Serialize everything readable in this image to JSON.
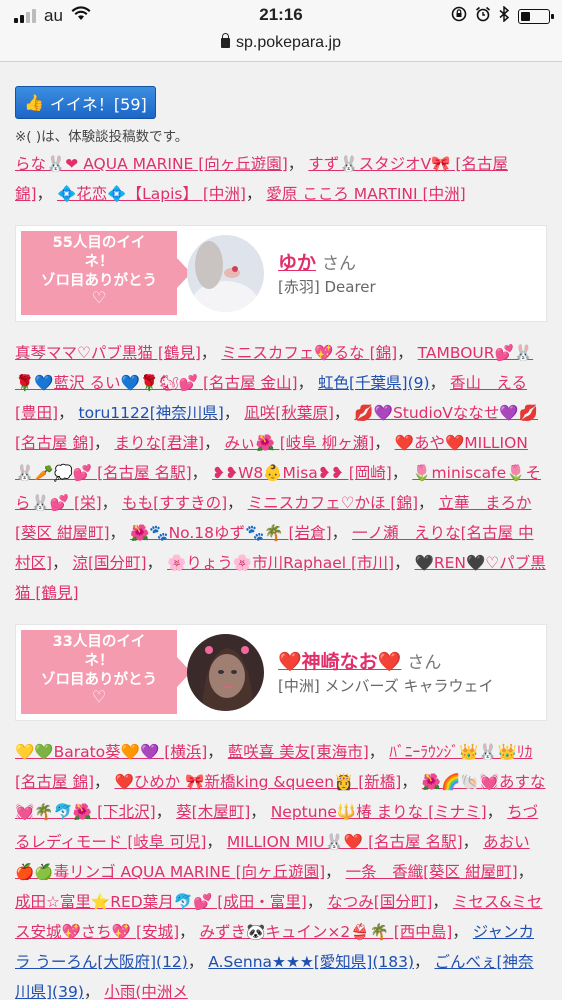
{
  "status_bar": {
    "carrier": "au",
    "time": "21:16",
    "battery_level": 0.35
  },
  "url_bar": {
    "domain": "sp.pokepara.jp"
  },
  "like_button": {
    "label": "イイネ！[59]"
  },
  "note": "※( )は、体験談投稿数です。",
  "cards": [
    {
      "banner_line1": "55人目のイイ",
      "banner_line2": "ネ！",
      "banner_line3": "ゾロ目ありがとう",
      "banner_heart": "♡",
      "name": "ゆか",
      "honorific": "さん",
      "shop": "[赤羽] Dearer"
    },
    {
      "banner_line1": "33人目のイイ",
      "banner_line2": "ネ！",
      "banner_line3": "ゾロ目ありがとう",
      "banner_heart": "♡",
      "name": "❤️神崎なお❤️",
      "honorific": "さん",
      "shop": "[中洲] メンバーズ キャラウェイ"
    }
  ],
  "likers_block_1": [
    {
      "text": "らな🐰❤ AQUA MARINE [向ヶ丘遊園]",
      "sep": "，"
    },
    {
      "text": "すず🐰スタジオV🎀 [名古屋 錦]",
      "sep": "，"
    },
    {
      "text": "💠花恋💠【Lapis】 [中洲]",
      "sep": "，"
    },
    {
      "text": "愛原 こころ MARTINI [中洲]",
      "sep": ""
    }
  ],
  "likers_block_2": [
    {
      "text": "真琴ママ♡パブ黒猫 [鶴見]",
      "sep": "，"
    },
    {
      "text": "ミニスカフェ💖るな [錦]",
      "sep": "，"
    },
    {
      "text": "TAMBOUR💕🐰🌹💙藍沢 るい💙🌹🐿💕 [名古屋 金山]",
      "sep": "，"
    },
    {
      "text": "虹色[千葉県](9)",
      "sep": "，",
      "blue": true
    },
    {
      "text": "香山　える[豊田]",
      "sep": "，"
    },
    {
      "text": "toru1122[神奈川県]",
      "sep": "，",
      "blue": true
    },
    {
      "text": "凪咲[秋葉原]",
      "sep": "，"
    },
    {
      "text": "💋💜StudioVななせ💜💋 [名古屋 錦]",
      "sep": "，"
    },
    {
      "text": "まりな[君津]",
      "sep": "，"
    },
    {
      "text": "みぃ🌺 [岐阜 柳ヶ瀬]",
      "sep": "，"
    },
    {
      "text": "❤️あや❤️MILLION🐰🥕💭💕 [名古屋 名駅]",
      "sep": "，"
    },
    {
      "text": "❥❥W8👶Misa❥❥ [岡崎]",
      "sep": "，"
    },
    {
      "text": "🌷miniscafe🌷そら🐰💕 [栄]",
      "sep": "，"
    },
    {
      "text": "もも[すすきの]",
      "sep": "，"
    },
    {
      "text": "ミニスカフェ♡かほ [錦]",
      "sep": "，"
    },
    {
      "text": "立華　まろか[葵区 紺屋町]",
      "sep": "，"
    },
    {
      "text": "🌺🐾No.18ゆず🐾🌴 [岩倉]",
      "sep": "，"
    },
    {
      "text": "一ノ瀬　えりな[名古屋 中村区]",
      "sep": "，"
    },
    {
      "text": "涼[国分町]",
      "sep": "，"
    },
    {
      "text": "🌸りょう🌸市川Raphael [市川]",
      "sep": "，"
    },
    {
      "text": "🖤REN🖤♡パブ黒猫 [鶴見]",
      "sep": ""
    }
  ],
  "likers_block_3": [
    {
      "text": "💛💚Barato葵🧡💜 [横浜]",
      "sep": "，"
    },
    {
      "text": "藍咲喜 美友[東海市]",
      "sep": "，"
    },
    {
      "text": "ﾊﾞﾆｰﾗｳﾝｼﾞ👑🐰👑ﾘｶ [名古屋 錦]",
      "sep": "，"
    },
    {
      "text": "❤️ひめか 🎀新橋king &queen👸 [新橋]",
      "sep": "，"
    },
    {
      "text": "🌺🌈🐚💓あすな💓🌴🐬🌺 [下北沢]",
      "sep": "，"
    },
    {
      "text": "葵[木屋町]",
      "sep": "，"
    },
    {
      "text": "Neptune🔱椿 まりな [ミナミ]",
      "sep": "，"
    },
    {
      "text": "ちづるレディモード [岐阜 可児]",
      "sep": "，"
    },
    {
      "text": "MILLION MIU🐰❤️ [名古屋 名駅]",
      "sep": "，"
    },
    {
      "text": "あおい🍎🍏毒リンゴ AQUA MARINE [向ヶ丘遊園]",
      "sep": "，"
    },
    {
      "text": "一条　香織[葵区 紺屋町]",
      "sep": "，"
    },
    {
      "text": "成田☆富里⭐RED葉月🐬💕 [成田・富里]",
      "sep": "，"
    },
    {
      "text": "なつみ[国分町]",
      "sep": "，"
    },
    {
      "text": "ミセス&ミセス安城💖さち💖 [安城]",
      "sep": "，"
    },
    {
      "text": "みずき🐼キュイン×2👙🌴 [西中島]",
      "sep": "，"
    },
    {
      "text": "ジャンカラ うーろん[大阪府](12)",
      "sep": "，",
      "blue": true
    },
    {
      "text": "A.Senna★★★[愛知県](183)",
      "sep": "，",
      "blue": true
    },
    {
      "text": "ごんべぇ[神奈川県](39)",
      "sep": "，",
      "blue": true
    },
    {
      "text": "小雨(中洲メ",
      "sep": ""
    }
  ]
}
